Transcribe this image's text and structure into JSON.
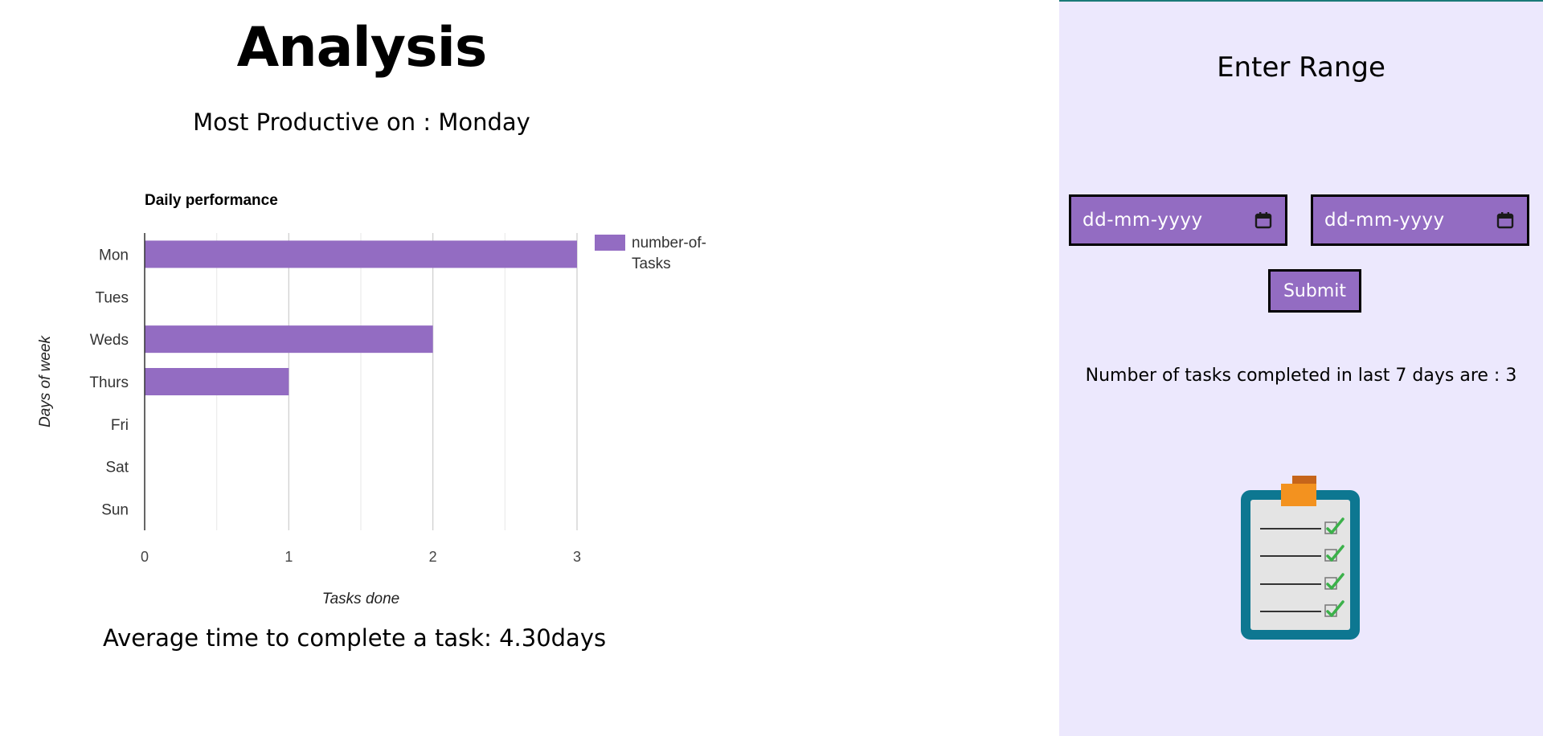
{
  "header": {
    "title": "Analysis",
    "most_productive": "Most Productive on : Monday",
    "average_time": "Average time to complete a task: 4.30days"
  },
  "sidebar": {
    "title": "Enter Range",
    "start_date_placeholder": "dd-mm-yyyy",
    "end_date_placeholder": "dd-mm-yyyy",
    "submit_label": "Submit",
    "tasks_completed": "Number of tasks completed in last 7 days are : 3"
  },
  "colors": {
    "accent": "#936cc2",
    "sidebar_bg": "#ece8fd",
    "top_line": "#1a7a78"
  },
  "icons": {
    "calendar": "calendar-icon",
    "illustration": "clipboard-checklist-icon"
  },
  "chart_data": {
    "type": "bar",
    "orientation": "horizontal",
    "title": "Daily performance",
    "xlabel": "Tasks done",
    "ylabel": "Days of week",
    "categories": [
      "Mon",
      "Tues",
      "Weds",
      "Thurs",
      "Fri",
      "Sat",
      "Sun"
    ],
    "series": [
      {
        "name": "number-of-Tasks",
        "values": [
          3,
          0,
          2,
          1,
          0,
          0,
          0
        ],
        "color": "#936cc2"
      }
    ],
    "xlim": [
      0,
      3
    ],
    "xticks": [
      "0",
      "1",
      "2",
      "3"
    ],
    "grid": true,
    "legend": "right"
  }
}
